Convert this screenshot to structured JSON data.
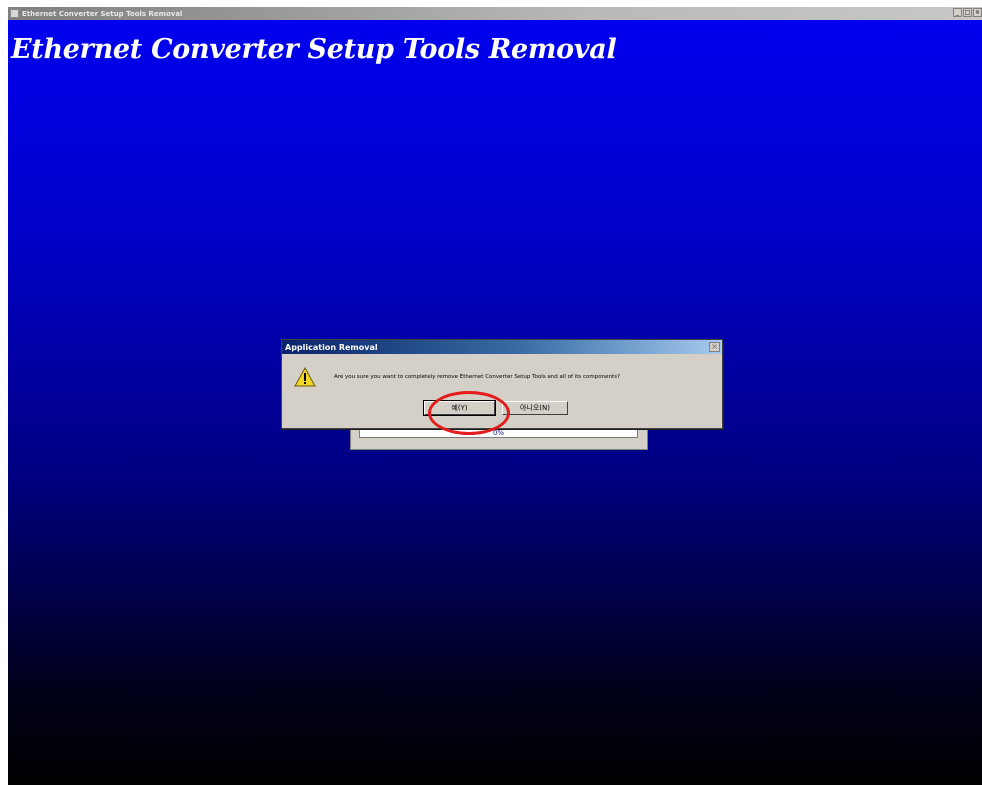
{
  "window": {
    "title": "Ethernet Converter Setup Tools Removal",
    "controls": [
      "_",
      "□",
      "×"
    ]
  },
  "app": {
    "heading": "Ethernet Converter Setup Tools Removal"
  },
  "progress": {
    "text": "0%",
    "value": 0
  },
  "dialog": {
    "title": "Application Removal",
    "close_label": "×",
    "icon": "warning-icon",
    "message": "Are you sure you want to completely remove Ethernet Converter Setup Tools and all of its components?",
    "yes_label": "예(Y)",
    "no_label": "아니오(N)"
  },
  "annotation": {
    "highlight_color": "#e41c1c",
    "target": "yes-button"
  },
  "colors": {
    "background_top": "#0000ee",
    "background_bottom": "#000000",
    "dialog_title_start": "#0a246a",
    "dialog_title_end": "#a6caf0"
  }
}
